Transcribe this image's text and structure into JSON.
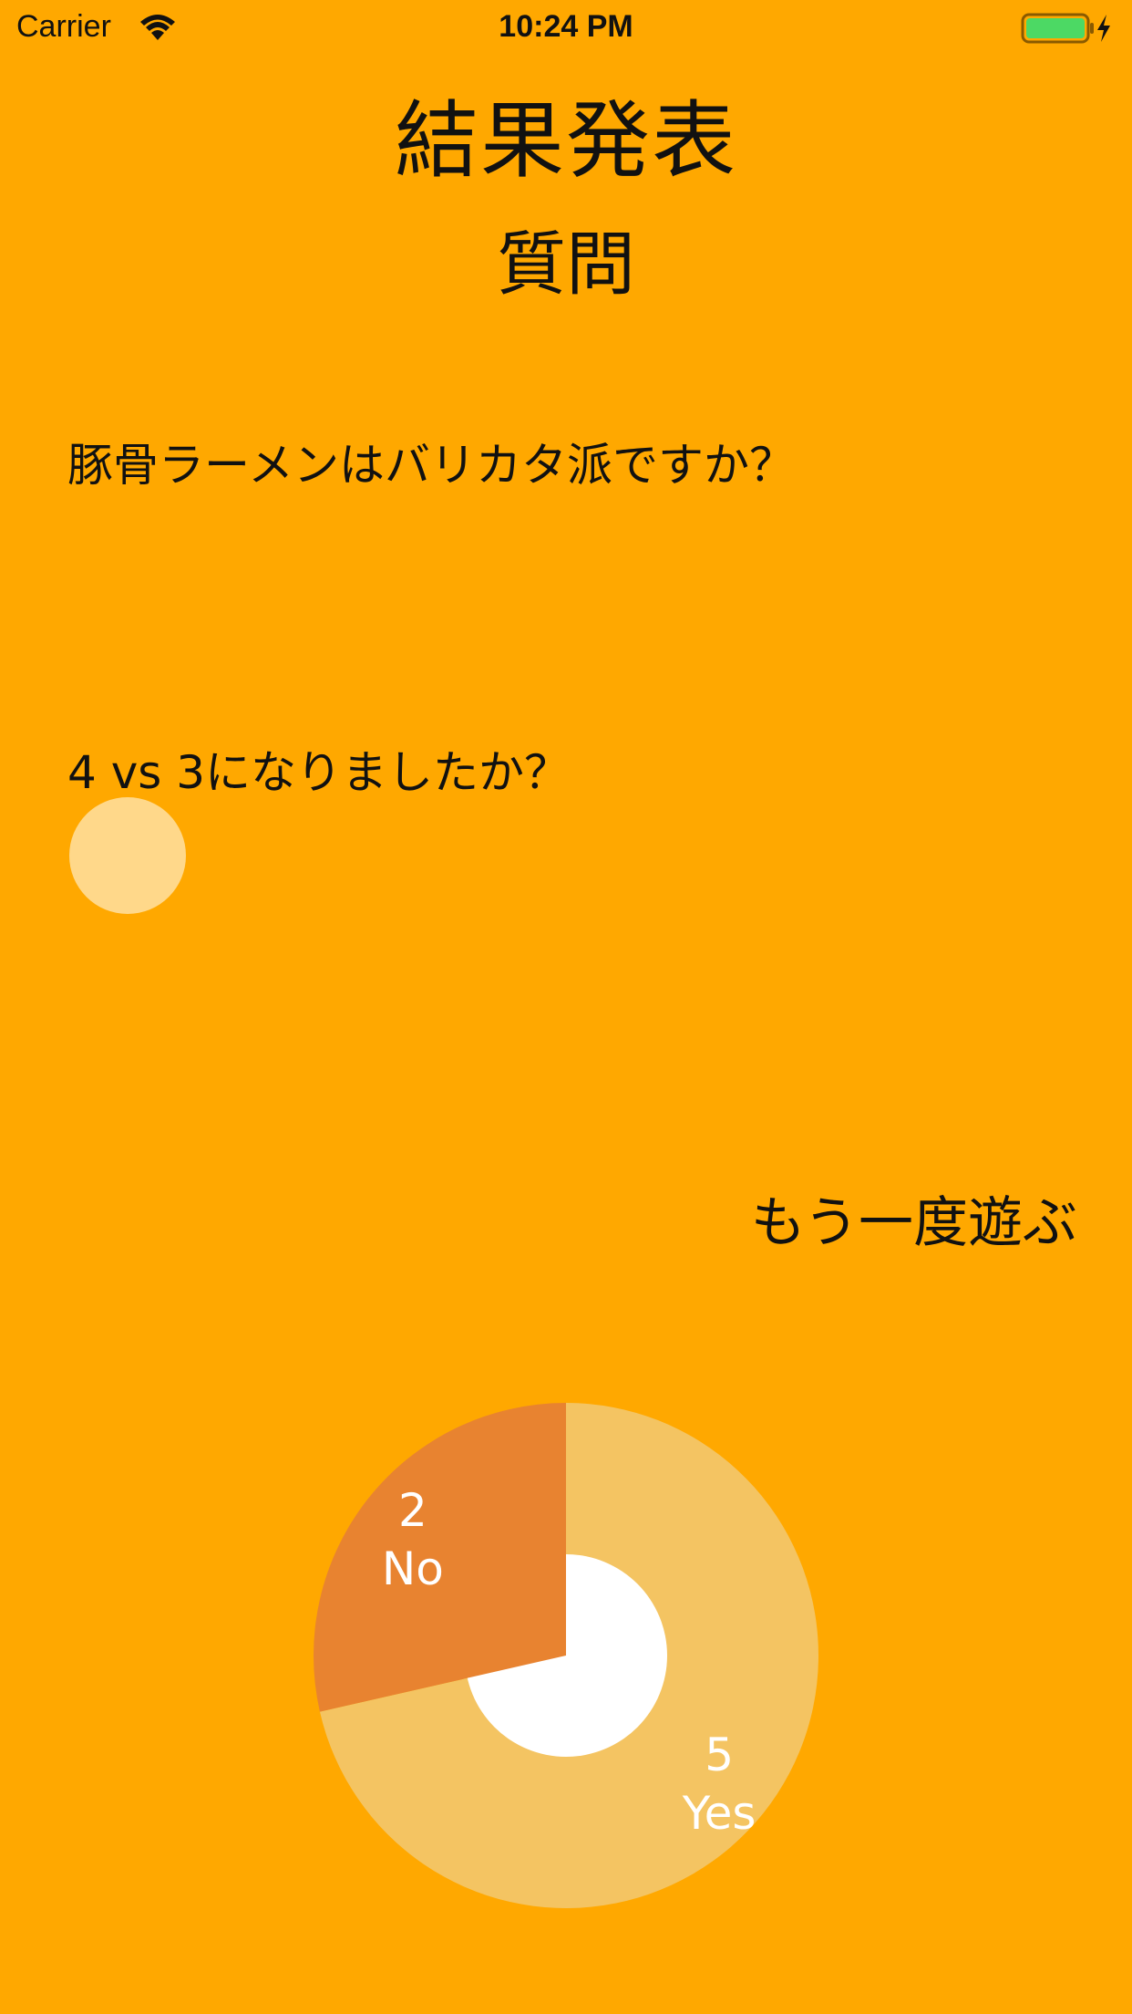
{
  "status_bar": {
    "carrier": "Carrier",
    "time": "10:24 PM",
    "wifi_icon": "wifi-icon",
    "battery_icon": "battery-icon",
    "charging_icon": "bolt-icon",
    "battery_fill_color": "#4CD964"
  },
  "header": {
    "title": "結果発表",
    "subtitle": "質問"
  },
  "question": {
    "text": "豚骨ラーメンはバリカタ派ですか？"
  },
  "result": {
    "text": "4  vs  3になりましたか？",
    "dot_color": "#FFD88A"
  },
  "actions": {
    "replay_label": "もう一度遊ぶ"
  },
  "chart_data": {
    "type": "pie",
    "donut": true,
    "slices": [
      {
        "label": "Yes",
        "value": 5,
        "color": "#F4C462"
      },
      {
        "label": "No",
        "value": 2,
        "color": "#E88330"
      }
    ],
    "center_color": "#FFFFFF"
  }
}
